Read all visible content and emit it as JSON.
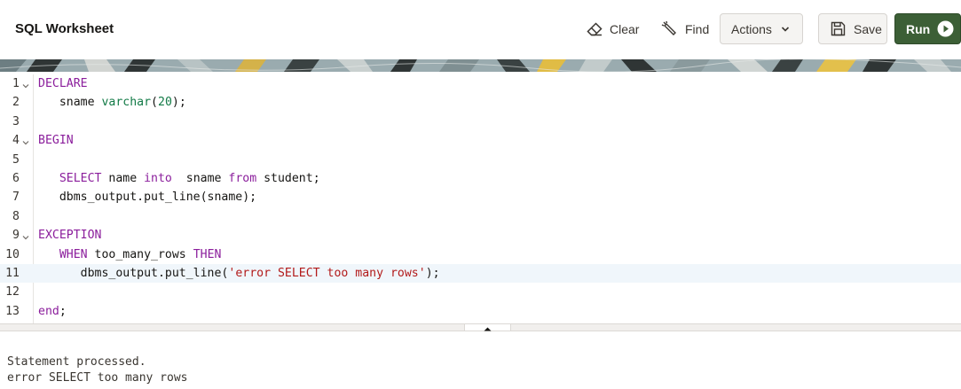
{
  "header": {
    "title": "SQL Worksheet",
    "clear_label": "Clear",
    "find_label": "Find",
    "actions_label": "Actions",
    "save_label": "Save",
    "run_label": "Run"
  },
  "icons": {
    "clear": "eraser-icon",
    "find": "flashlight-icon",
    "actions": "chevron-down-icon",
    "save": "floppy-disk-icon",
    "run": "play-circle-icon"
  },
  "colors": {
    "run_button": "#3c5f36",
    "keyword": "#8b1e9c",
    "type": "#127a46",
    "string": "#b21a1a",
    "active_line": "#f0f6fb"
  },
  "editor": {
    "active_line": 11,
    "lines": [
      {
        "n": "1",
        "fold": true,
        "tokens": [
          {
            "t": "DECLARE",
            "c": "kw"
          }
        ]
      },
      {
        "n": "2",
        "fold": false,
        "tokens": [
          {
            "t": "   sname ",
            "c": ""
          },
          {
            "t": "varchar",
            "c": "ty"
          },
          {
            "t": "(",
            "c": ""
          },
          {
            "t": "20",
            "c": "num"
          },
          {
            "t": ");",
            "c": ""
          }
        ]
      },
      {
        "n": "3",
        "fold": false,
        "tokens": []
      },
      {
        "n": "4",
        "fold": true,
        "tokens": [
          {
            "t": "BEGIN",
            "c": "kw"
          }
        ]
      },
      {
        "n": "5",
        "fold": false,
        "tokens": []
      },
      {
        "n": "6",
        "fold": false,
        "tokens": [
          {
            "t": "   ",
            "c": ""
          },
          {
            "t": "SELECT",
            "c": "kw"
          },
          {
            "t": " name ",
            "c": ""
          },
          {
            "t": "into",
            "c": "kw"
          },
          {
            "t": "  sname ",
            "c": ""
          },
          {
            "t": "from",
            "c": "kw"
          },
          {
            "t": " student;",
            "c": ""
          }
        ]
      },
      {
        "n": "7",
        "fold": false,
        "tokens": [
          {
            "t": "   dbms_output.put_line(sname);",
            "c": ""
          }
        ]
      },
      {
        "n": "8",
        "fold": false,
        "tokens": []
      },
      {
        "n": "9",
        "fold": true,
        "tokens": [
          {
            "t": "EXCEPTION",
            "c": "kw"
          }
        ]
      },
      {
        "n": "10",
        "fold": false,
        "tokens": [
          {
            "t": "   ",
            "c": ""
          },
          {
            "t": "WHEN",
            "c": "kw"
          },
          {
            "t": " too_many_rows ",
            "c": ""
          },
          {
            "t": "THEN",
            "c": "kw"
          }
        ]
      },
      {
        "n": "11",
        "fold": false,
        "tokens": [
          {
            "t": "      dbms_output.put_line(",
            "c": ""
          },
          {
            "t": "'error SELECT too many rows'",
            "c": "str"
          },
          {
            "t": ");",
            "c": ""
          }
        ]
      },
      {
        "n": "12",
        "fold": false,
        "tokens": []
      },
      {
        "n": "13",
        "fold": false,
        "tokens": [
          {
            "t": "end",
            "c": "kw"
          },
          {
            "t": ";",
            "c": ""
          }
        ]
      }
    ]
  },
  "output": {
    "lines": [
      "Statement processed.",
      "error SELECT too many rows"
    ]
  }
}
